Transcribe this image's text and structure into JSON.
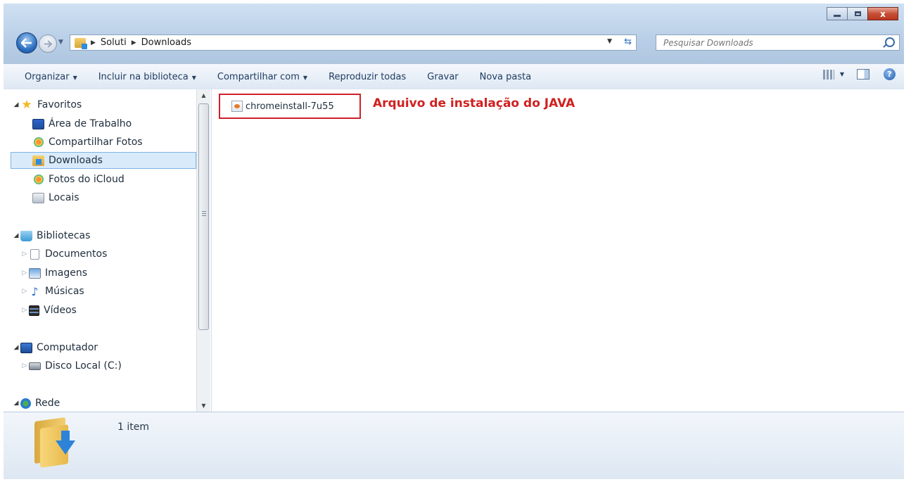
{
  "window": {
    "controls": {
      "minimize": "minimize",
      "maximize": "maximize",
      "close": "x"
    }
  },
  "navigation": {
    "breadcrumb": [
      "Soluti",
      "Downloads"
    ],
    "search_placeholder": "Pesquisar Downloads"
  },
  "toolbar": {
    "items": [
      {
        "label": "Organizar",
        "dropdown": true
      },
      {
        "label": "Incluir na biblioteca",
        "dropdown": true
      },
      {
        "label": "Compartilhar com",
        "dropdown": true
      },
      {
        "label": "Reproduzir todas",
        "dropdown": false
      },
      {
        "label": "Gravar",
        "dropdown": false
      },
      {
        "label": "Nova pasta",
        "dropdown": false
      }
    ],
    "help_glyph": "?"
  },
  "sidebar": {
    "favorites": {
      "label": "Favoritos",
      "items": [
        {
          "label": "Área de Trabalho",
          "icon": "desktop-icon"
        },
        {
          "label": "Compartilhar Fotos",
          "icon": "photo-stream-icon"
        },
        {
          "label": "Downloads",
          "icon": "downloads-folder-icon",
          "selected": true
        },
        {
          "label": "Fotos do iCloud",
          "icon": "icloud-photos-icon"
        },
        {
          "label": "Locais",
          "icon": "places-icon"
        }
      ]
    },
    "libraries": {
      "label": "Bibliotecas",
      "items": [
        {
          "label": "Documentos",
          "icon": "documents-icon"
        },
        {
          "label": "Imagens",
          "icon": "images-icon"
        },
        {
          "label": "Músicas",
          "icon": "music-icon"
        },
        {
          "label": "Vídeos",
          "icon": "videos-icon"
        }
      ]
    },
    "computer": {
      "label": "Computador",
      "items": [
        {
          "label": "Disco Local (C:)",
          "icon": "local-disk-icon"
        }
      ]
    },
    "network": {
      "label": "Rede"
    }
  },
  "content": {
    "files": [
      {
        "name": "chromeinstall-7u55",
        "icon": "java-installer-icon"
      }
    ],
    "annotation": "Arquivo de instalação do JAVA",
    "annotation_color": "#d12020"
  },
  "status": {
    "item_count": "1 item"
  },
  "colors": {
    "frame": "#c4d6ea",
    "selection": "#d9ebfa",
    "highlight_border": "#d0202a"
  }
}
